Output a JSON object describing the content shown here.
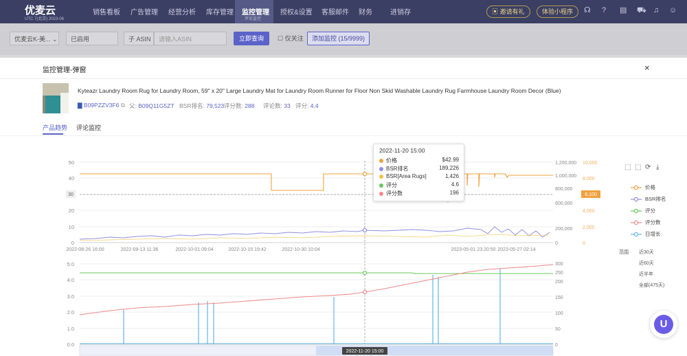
{
  "topnav": {
    "logo": "优麦云",
    "logo_sub": "UTC 7(北京) 2023-06",
    "items": [
      "销售看板",
      "广告管理",
      "经营分析",
      "库存管理",
      "监控管理",
      "授权&设置",
      "客服邮件",
      "财务",
      "进销存"
    ],
    "active_sub": "评论监控",
    "invite_label": "邀请有礼",
    "trial_label": "体验小程序"
  },
  "filters": {
    "store": "优麦云K-美...",
    "status": "已启用",
    "asin_type": "子 ASIN",
    "asin_placeholder": "请输入ASIN",
    "query_button": "立即查询",
    "follow_label": "仅关注",
    "add_button": "添加监控 (15/9999)"
  },
  "modal": {
    "title": "监控管理-弹窗",
    "close": "×"
  },
  "product": {
    "title": "Kyteazr Laundry Room Rug for Laundry Room, 59\" x 20\" Large Laundry Mat for Laundry Room Runner for Floor Non Skid Washable Laundry Rug Farmhouse Laundry Room Decor (Blue)",
    "asin": "B09PZZV3F6",
    "parent_label": "父:",
    "parent_asin": "B09Q11G5ZT",
    "bsr_label": "BSR排名:",
    "bsr_value": "79,523",
    "reviews_label": "评分数:",
    "reviews_value": "288",
    "ratings_label": "评论数:",
    "ratings_value": "33",
    "score_label": "评分:",
    "score_value": "4.4"
  },
  "tabs": [
    "产品趋势",
    "评论监控"
  ],
  "legend": {
    "items": [
      {
        "label": "价格",
        "color": "#f0a13d"
      },
      {
        "label": "BSR排名",
        "color": "#8f8de0"
      },
      {
        "label": "评分",
        "color": "#67c95a"
      },
      {
        "label": "评分数",
        "color": "#f08a8a"
      },
      {
        "label": "日增长",
        "color": "#63b5e8"
      }
    ]
  },
  "range": {
    "label": "范围",
    "options": [
      "近30天",
      "近60天",
      "近半年",
      "全部(475天)"
    ]
  },
  "tooltip": {
    "time": "2022-11-20 15:00",
    "rows": [
      {
        "label": "价格",
        "value": "$42.99",
        "color": "#f0a13d"
      },
      {
        "label": "BSR排名",
        "value": "189,226",
        "color": "#8f8de0"
      },
      {
        "label": "BSR[Area Rugs]",
        "value": "1,426",
        "color": "#f5c04a"
      },
      {
        "label": "评分",
        "value": "4.6",
        "color": "#67c95a"
      },
      {
        "label": "评分数",
        "value": "196",
        "color": "#f08a8a"
      }
    ]
  },
  "chat_icon": "U",
  "chart_data": [
    {
      "type": "line",
      "x_ticks": [
        "2022-08-26 16:00",
        "2022-09-13 11:36",
        "2022-10-01 09:04",
        "2022-10-15 19:42",
        "2022-10-30 10:04",
        "2023-05-01 23:20:50",
        "2023-05-27 02:14"
      ],
      "y_left_ticks": [
        "0",
        "10",
        "20",
        "30",
        "40",
        "50"
      ],
      "y_right_ticks": [
        "0",
        "200,000",
        "400,000",
        "600,000",
        "800,000",
        "1,000,000",
        "1,200,000"
      ],
      "y_right2_ticks": [
        "0",
        "2,000",
        "4,000",
        "6,000",
        "8,000",
        "10,000"
      ],
      "crosshair_left": "30",
      "crosshair_right2": "6,100",
      "series": [
        {
          "name": "价格",
          "color": "#f0a13d",
          "x": [
            0,
            0.53,
            0.53,
            0.61,
            0.61,
            0.9,
            1
          ],
          "y": [
            42,
            42,
            33,
            33,
            42.99,
            42.5,
            42.5
          ]
        },
        {
          "name": "BSR排名",
          "color": "#8f8de0",
          "x": [
            0,
            0.2,
            0.4,
            0.6,
            0.8,
            1
          ],
          "y": [
            120000,
            150000,
            170000,
            189226,
            200000,
            160000
          ]
        }
      ]
    },
    {
      "type": "line",
      "x_ticks": [
        "2022-11-20 15:00"
      ],
      "y_left_ticks": [
        "0.0",
        "1.0",
        "2.0",
        "3.0",
        "4.0",
        "5.0"
      ],
      "y_right_ticks": [
        "0",
        "50",
        "100",
        "150",
        "200",
        "250",
        "300"
      ],
      "series": [
        {
          "name": "评分",
          "color": "#67c95a",
          "x": [
            0,
            0.7,
            0.7,
            1
          ],
          "y": [
            4.6,
            4.6,
            4.5,
            4.5
          ]
        },
        {
          "name": "评分数",
          "color": "#f08a8a",
          "x": [
            0,
            0.25,
            0.5,
            0.75,
            1
          ],
          "y": [
            100,
            135,
            170,
            235,
            288
          ]
        }
      ]
    }
  ]
}
